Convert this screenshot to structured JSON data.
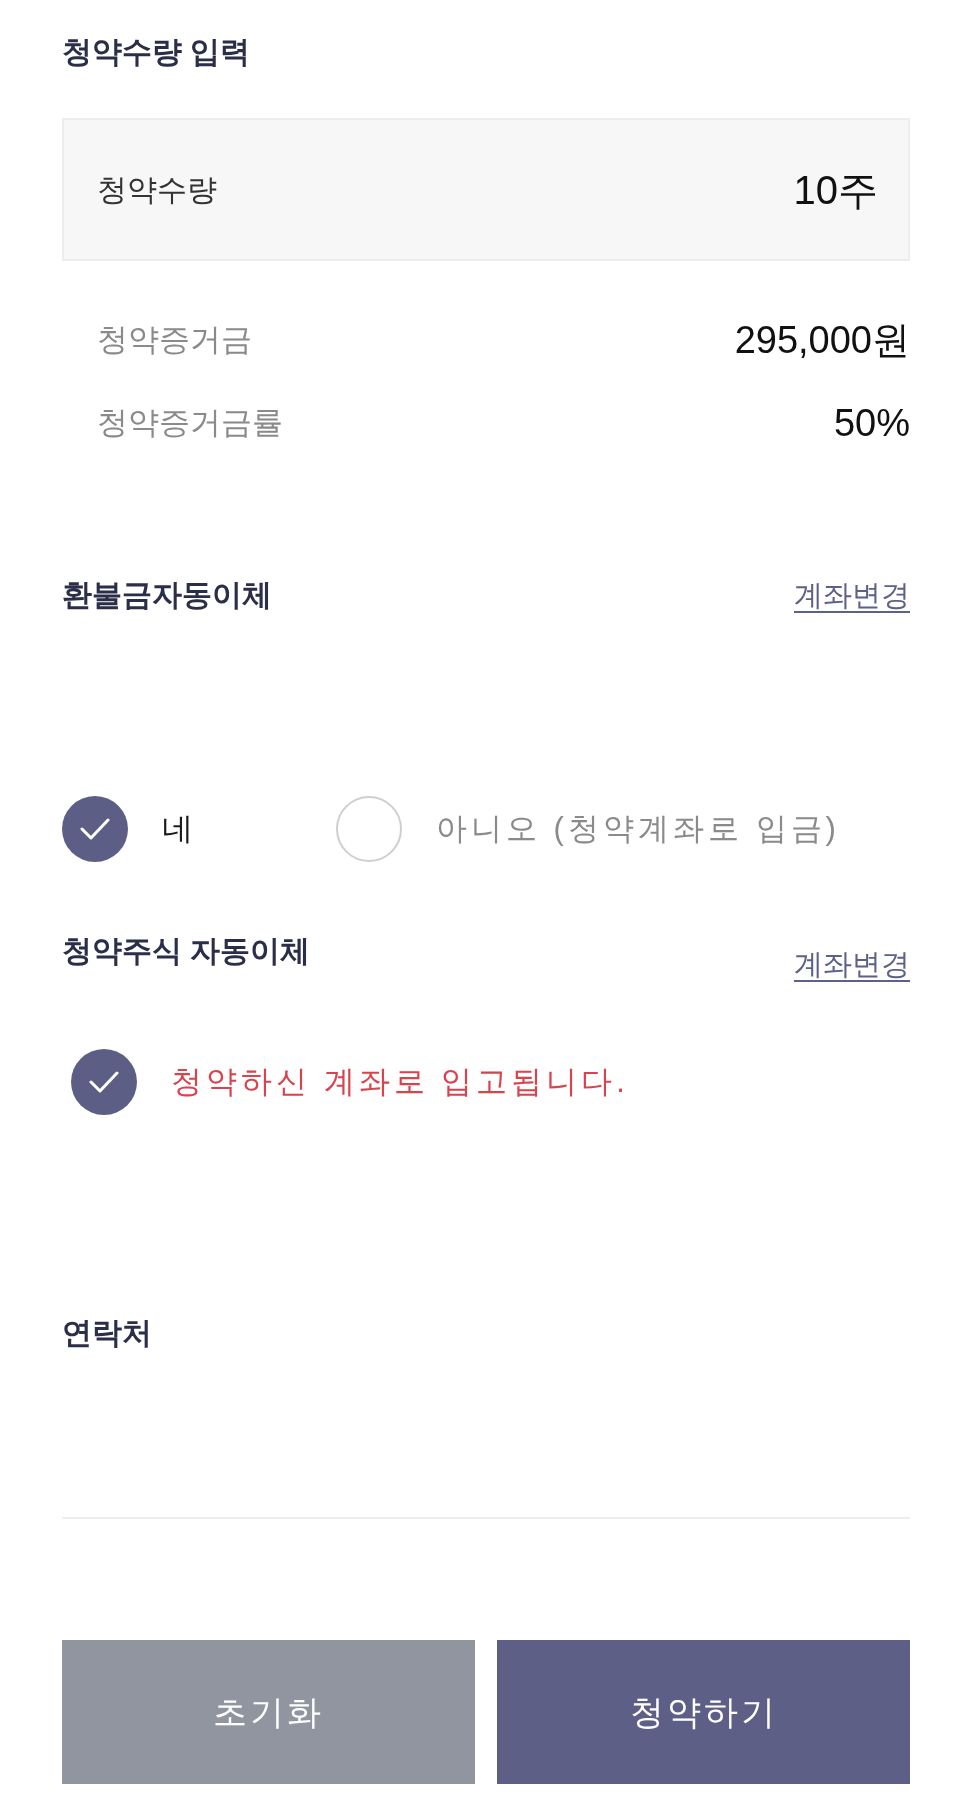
{
  "quantity_section": {
    "title": "청약수량 입력",
    "field": {
      "label": "청약수량",
      "value": "10주"
    },
    "details": [
      {
        "label": "청약증거금",
        "value": "295,000원"
      },
      {
        "label": "청약증거금률",
        "value": "50%"
      }
    ]
  },
  "refund_transfer": {
    "title": "환불금자동이체",
    "link": "계좌변경",
    "options": [
      {
        "label": "네",
        "selected": true
      },
      {
        "label": "아니오 (청약계좌로 입금)",
        "selected": false
      }
    ]
  },
  "stock_transfer": {
    "title": "청약주식 자동이체",
    "link": "계좌변경",
    "notice": {
      "text": "청약하신 계좌로 입고됩니다.",
      "checked": true
    }
  },
  "contact": {
    "title": "연락처"
  },
  "buttons": [
    {
      "label": "초기화",
      "kind": "secondary"
    },
    {
      "label": "청약하기",
      "kind": "primary"
    }
  ]
}
